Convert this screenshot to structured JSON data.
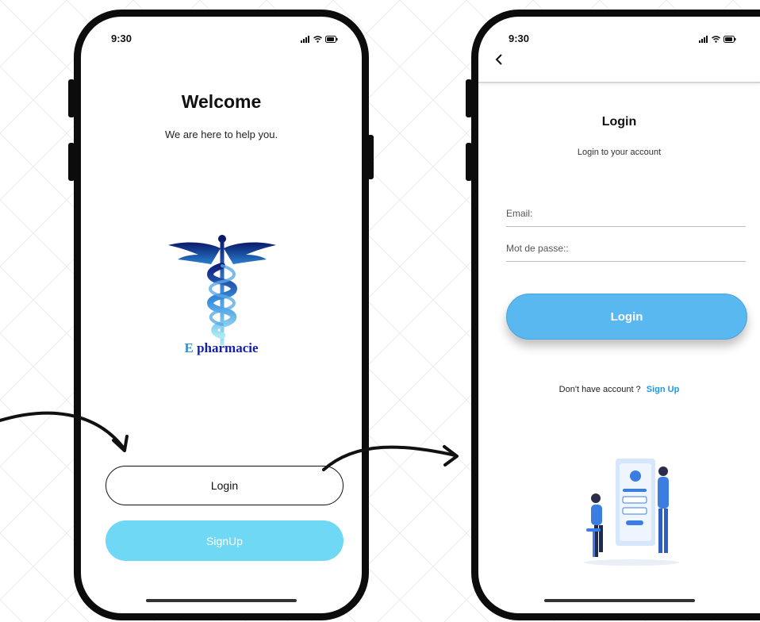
{
  "screens": {
    "welcome": {
      "status_time": "9:30",
      "title": "Welcome",
      "subtitle": "We are here to help you.",
      "logo_text_e": "E",
      "logo_text_rest": "pharmacie",
      "login_button": "Login",
      "signup_button": "SignUp"
    },
    "login": {
      "status_time": "9:30",
      "back_icon": "chevron-left-icon",
      "title": "Login",
      "subtitle": "Login to your account",
      "email_placeholder": "Email:",
      "password_placeholder": "Mot de passe::",
      "login_button": "Login",
      "no_account_text": "Don't have account ?",
      "signup_link": "Sign Up"
    }
  },
  "colors": {
    "signup_button": "#6fd9f5",
    "login_primary": "#5ab8f0",
    "link": "#1c9ae6",
    "frame": "#0c0c0c"
  }
}
